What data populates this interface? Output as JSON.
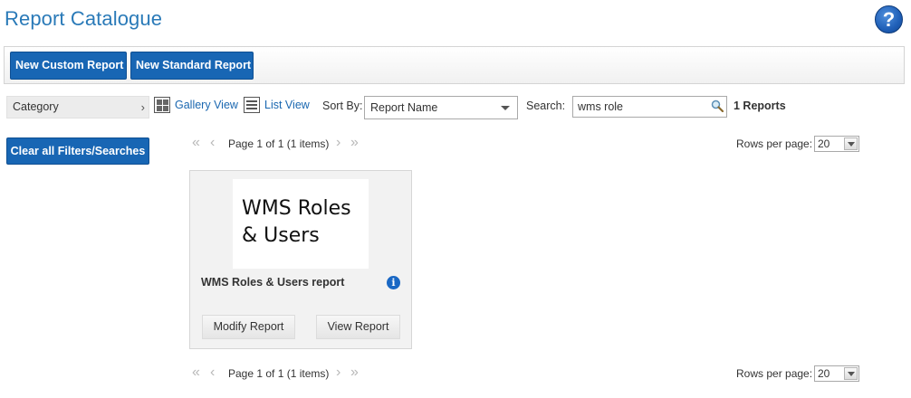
{
  "header": {
    "title": "Report Catalogue",
    "help_icon": "question-mark-icon",
    "help_symbol": "?"
  },
  "toolbar": {
    "new_custom_label": "New Custom Report",
    "new_standard_label": "New Standard Report"
  },
  "sidebar": {
    "category_label": "Category",
    "category_chevron": "›",
    "clear_label": "Clear all Filters/Searches"
  },
  "view": {
    "gallery_label": "Gallery View",
    "list_label": "List View"
  },
  "sort": {
    "label": "Sort By:",
    "value": "Report Name"
  },
  "search": {
    "label": "Search:",
    "value": "wms role"
  },
  "result_count": "1 Reports",
  "pager": {
    "text": "Page 1 of 1 (1 items)",
    "rows_label": "Rows per page:",
    "rows_value": "20"
  },
  "reports": [
    {
      "thumbnail_line1": "WMS Roles",
      "thumbnail_line2": "& Users",
      "title": "WMS Roles & Users report",
      "modify_label": "Modify Report",
      "view_label": "View Report",
      "info_symbol": "i"
    }
  ],
  "colors": {
    "accent": "#1866b4",
    "title": "#2a7ab8",
    "link": "#1a67b0"
  }
}
